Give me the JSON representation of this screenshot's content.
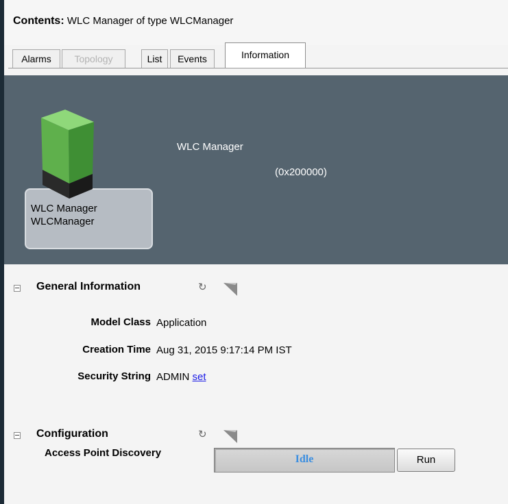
{
  "header": {
    "label": "Contents:",
    "title": "WLC Manager of type WLCManager"
  },
  "tabs": [
    {
      "label": "Alarms",
      "state": "normal"
    },
    {
      "label": "Topology",
      "state": "disabled"
    },
    {
      "label": "List",
      "state": "normal"
    },
    {
      "label": "Events",
      "state": "normal"
    },
    {
      "label": "Information",
      "state": "active"
    }
  ],
  "banner": {
    "icon_name": "cube-icon",
    "icon_line1": "WLC Manager",
    "icon_line2": "WLCManager",
    "name": "WLC Manager",
    "handle": "(0x200000)",
    "colors": {
      "banner_bg": "#55646f",
      "cube_green": "#5fb04c"
    }
  },
  "general": {
    "title": "General Information",
    "properties": [
      {
        "label": "Model Class",
        "value": "Application"
      },
      {
        "label": "Creation Time",
        "value": "Aug 31, 2015 9:17:14 PM IST"
      },
      {
        "label": "Security String",
        "value": "ADMIN",
        "link": "set"
      }
    ]
  },
  "configuration": {
    "title": "Configuration",
    "ap_discovery": {
      "label": "Access Point Discovery",
      "status": "Idle",
      "button": "Run"
    }
  }
}
